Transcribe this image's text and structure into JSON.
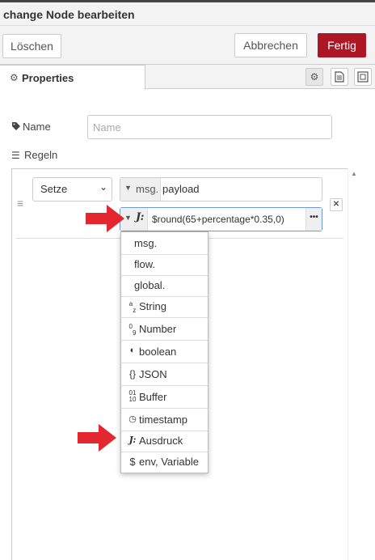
{
  "dialog": {
    "title": "change Node bearbeiten"
  },
  "toolbar": {
    "delete_label": "Löschen",
    "cancel_label": "Abbrechen",
    "done_label": "Fertig"
  },
  "tabs": {
    "properties_label": "Properties"
  },
  "form": {
    "name_label": "Name",
    "name_placeholder": "Name",
    "name_value": "",
    "rules_label": "Regeln"
  },
  "rule": {
    "action": "Setze",
    "property_type": "msg.",
    "property_value": "payload",
    "expression_value": "$round(65+percentage*0.35,0)"
  },
  "type_menu": [
    {
      "icon": "",
      "label": "msg."
    },
    {
      "icon": "",
      "label": "flow."
    },
    {
      "icon": "",
      "label": "global."
    },
    {
      "icon": "az-string-icon",
      "label": "String"
    },
    {
      "icon": "09-number-icon",
      "label": "Number"
    },
    {
      "icon": "boolean-icon",
      "label": "boolean"
    },
    {
      "icon": "braces-json-icon",
      "label": "JSON"
    },
    {
      "icon": "binary-buffer-icon",
      "label": "Buffer"
    },
    {
      "icon": "clock-icon",
      "label": "timestamp"
    },
    {
      "icon": "jsonata-icon",
      "label": "Ausdruck"
    },
    {
      "icon": "dollar-icon",
      "label": "env, Variable"
    }
  ],
  "colors": {
    "primary": "#ad1625",
    "annotation_arrow": "#e3262f",
    "focus_border": "#6e9bd6"
  }
}
